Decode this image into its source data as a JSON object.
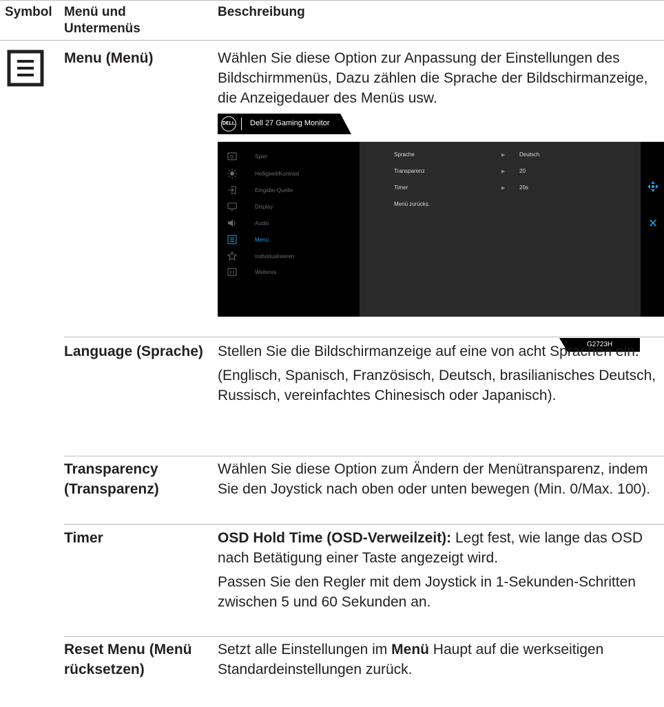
{
  "header": {
    "symbol": "Symbol",
    "menu": "Menü und Untermenüs",
    "description": "Beschreibung"
  },
  "rows": [
    {
      "name": "Menu (Menü)",
      "description": "Wählen Sie diese Option zur Anpassung der Einstellungen des Bildschirmmenüs, Dazu zählen die Sprache der Bildschirmanzeige, die Anzeigedauer des Menüs usw."
    },
    {
      "name": "Language (Sprache)",
      "description": "Stellen Sie die Bildschirmanzeige auf eine von acht Sprachen ein.",
      "description2": "(Englisch, Spanisch, Französisch, Deutsch, brasilianisches Deutsch, Russisch, vereinfachtes Chinesisch oder Japanisch)."
    },
    {
      "name": "Transparency (Transparenz)",
      "description": "Wählen Sie diese Option zum Ändern der Menütransparenz, indem Sie den Joystick nach oben oder unten bewegen (Min. 0/Max. 100)."
    },
    {
      "name": "Timer",
      "description_bold": "OSD Hold Time (OSD-Verweilzeit):",
      "description": " Legt fest, wie lange das OSD nach Betätigung einer Taste angezeigt wird.",
      "description2": "Passen Sie den Regler mit dem Joystick in 1-Sekunden-Schritten zwischen 5 und 60 Sekunden an."
    },
    {
      "name": "Reset Menu (Menü rücksetzen)",
      "description_pre": "Setzt alle Einstellungen im ",
      "description_bold": "Menü",
      "description_post": " Haupt auf die werkseitigen Standardeinstellungen zurück."
    }
  ],
  "osd": {
    "logo": "DELL",
    "title": "Dell 27 Gaming Monitor",
    "menu_items": [
      "Spiel",
      "Helligkeit/Kontrast",
      "Eingabe-Quelle",
      "Display",
      "Audio",
      "Menü",
      "Individualisieren",
      "Weiteres"
    ],
    "active_item": "Menü",
    "settings": [
      {
        "label": "Sprache",
        "value": "Deutsch"
      },
      {
        "label": "Transparenz",
        "value": "20"
      },
      {
        "label": "Timer",
        "value": "20s"
      },
      {
        "label": "Menü zurücks.",
        "value": ""
      }
    ],
    "model": "G2723H",
    "colors": {
      "accent": "#1aa0e6",
      "panel": "#2b2b2b",
      "background": "#000000"
    }
  },
  "icons": {
    "menu_symbol": "menu-list-icon",
    "nav": "joystick-nav-icon",
    "close": "close-icon"
  }
}
